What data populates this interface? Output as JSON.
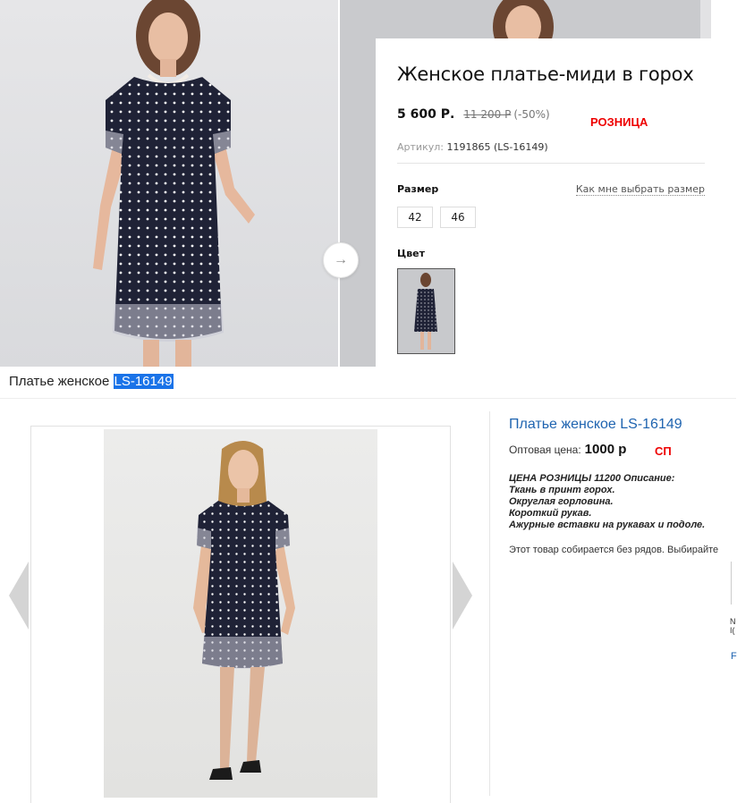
{
  "retail": {
    "title": "Женское платье-миди в горох",
    "price_now": "5 600 Р.",
    "price_old": "11 200 Р",
    "discount": "(-50%)",
    "tag": "РОЗНИЦА",
    "sku_label": "Артикул:",
    "sku_value": "1191865 (LS-16149)",
    "size_label": "Размер",
    "size_help": "Как мне выбрать размер",
    "sizes": [
      "42",
      "46"
    ],
    "color_label": "Цвет",
    "next_arrow": "→"
  },
  "wholesale": {
    "heading_prefix": "Платье женское",
    "heading_code": "LS-16149",
    "title": "Платье женское LS-16149",
    "price_label": "Оптовая цена:",
    "price_value": "1000 р",
    "tag": "СП",
    "desc": [
      "ЦЕНА РОЗНИЦЫ 11200 Описание:",
      "Ткань в принт горох.",
      "Округлая горловина.",
      "Короткий рукав.",
      "Ажурные вставки на рукавах и подоле."
    ],
    "note": "Этот товар собирается без рядов. Выбирайте",
    "frag_lines": [
      "N",
      "I("
    ],
    "frag_link": "F"
  },
  "colors": {
    "dress": "#1f2236",
    "dots": "#ffffff",
    "link": "#1f64b0",
    "accent_red": "#e00000",
    "selection": "#1a73e8"
  }
}
